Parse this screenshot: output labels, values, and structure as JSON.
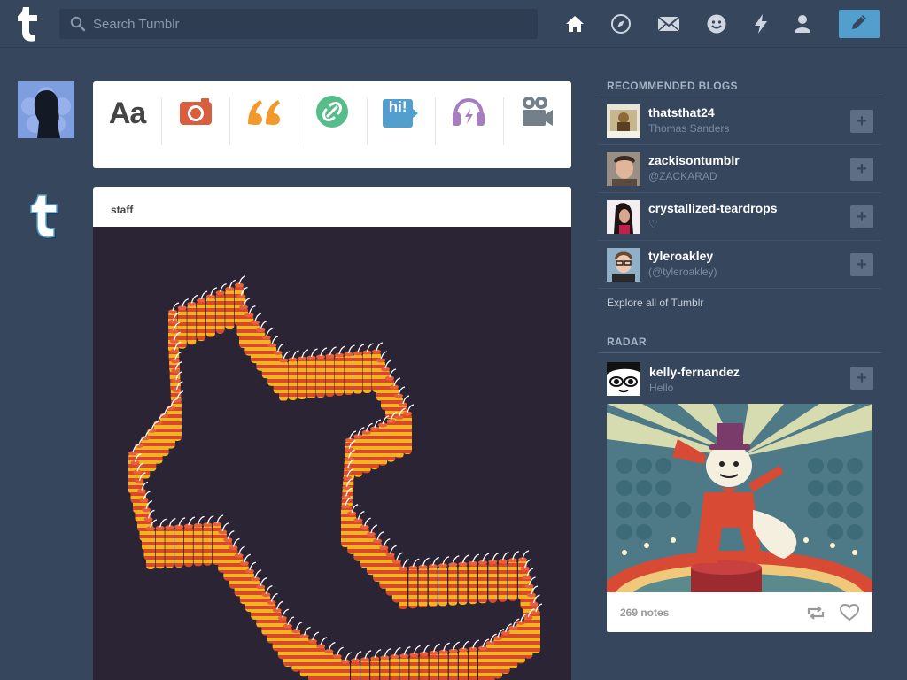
{
  "header": {
    "logo": "tumblr-logo",
    "search_placeholder": "Search Tumblr",
    "nav_icons": [
      "home-icon",
      "explore-icon",
      "inbox-icon",
      "messaging-icon",
      "activity-icon",
      "account-icon"
    ],
    "compose_icon": "pencil-icon",
    "accent_color": "#529ecc"
  },
  "post_types": [
    {
      "name": "text",
      "label": "Aa",
      "color": "#444444"
    },
    {
      "name": "photo",
      "icon": "camera-icon",
      "color": "#d95e40"
    },
    {
      "name": "quote",
      "icon": "quote-icon",
      "color": "#f2992e"
    },
    {
      "name": "link",
      "icon": "link-icon",
      "color": "#56bc8a"
    },
    {
      "name": "chat",
      "label": "hi!",
      "color": "#529ecc"
    },
    {
      "name": "audio",
      "icon": "headphones-icon",
      "color": "#a77dc2"
    },
    {
      "name": "video",
      "icon": "video-camera-icon",
      "color": "#748089"
    }
  ],
  "post": {
    "author": "staff"
  },
  "sidebar": {
    "recommended_title": "RECOMMENDED BLOGS",
    "recommended": [
      {
        "name": "thatsthat24",
        "sub": "Thomas Sanders"
      },
      {
        "name": "zackisontumblr",
        "sub": "@ZACKARAD"
      },
      {
        "name": "crystallized-teardrops",
        "sub": "♡"
      },
      {
        "name": "tyleroakley",
        "sub": "(@tyleroakley)"
      }
    ],
    "explore_label": "Explore all of Tumblr",
    "radar_title": "RADAR",
    "radar": {
      "name": "kelly-fernandez",
      "sub": "Hello",
      "notes": "269 notes"
    }
  }
}
